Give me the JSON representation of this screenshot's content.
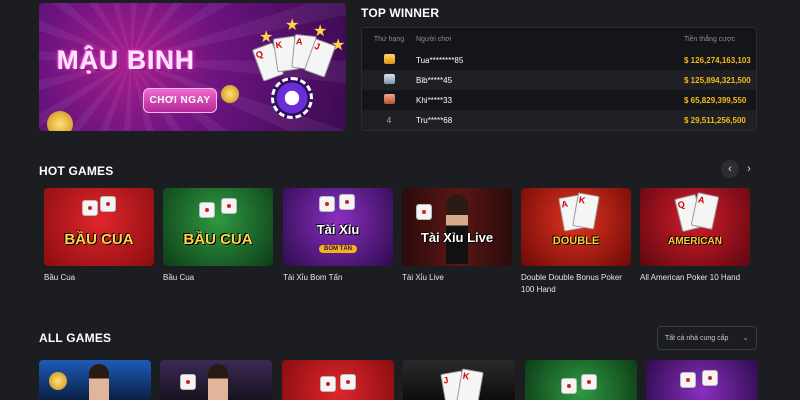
{
  "banner": {
    "title": "MẬU BINH",
    "button_label": "CHƠI NGAY"
  },
  "top_winner": {
    "title": "TOP WINNER",
    "headers": [
      "Thứ hạng",
      "Người chơi",
      "Tiền thắng cược"
    ],
    "rows": [
      {
        "rank": "",
        "medal": "gold-medal-icon",
        "player": "Tua********85",
        "amount": "$  126,274,163,103"
      },
      {
        "rank": "",
        "medal": "silver-medal-icon",
        "player": "Bib*****45",
        "amount": "$  125,894,321,500"
      },
      {
        "rank": "",
        "medal": "bronze-medal-icon",
        "player": "Khi*****33",
        "amount": "$  65,829,399,550"
      },
      {
        "rank": "4",
        "medal": "",
        "player": "Tru*****68",
        "amount": "$  29,511,256,500"
      }
    ]
  },
  "hot_games": {
    "title": "HOT GAMES",
    "prev_icon": "‹",
    "next_icon": "›",
    "items": [
      {
        "name": "Bầu Cua",
        "thumb_text": "BẦU CUA",
        "bg": "#b8141a"
      },
      {
        "name": "Bầu Cua",
        "thumb_text": "BẦU CUA",
        "bg": "#1b6b2a"
      },
      {
        "name": "Tài Xỉu Bom Tấn",
        "thumb_text": "Tài Xỉu",
        "thumb_sub": "BOM TẤN",
        "bg": "#5b1a8a"
      },
      {
        "name": "Tài Xỉu Live",
        "thumb_text": "Tài Xỉu Live",
        "bg": "#3a0f0f"
      },
      {
        "name": "Double Double Bonus Poker 100 Hand",
        "thumb_text": "DOUBLE",
        "bg": "#b0160f"
      },
      {
        "name": "All American Poker 10 Hand",
        "thumb_text": "AMERICAN",
        "bg": "#9c0e18"
      }
    ]
  },
  "all_games": {
    "title": "ALL GAMES",
    "provider_select": "Tất cả nhà cung cấp",
    "thumbs": [
      "#123a7a",
      "#2a1f3c",
      "#b3141a",
      "#1a1a1a",
      "#1d5e2c",
      "#5b1a8a"
    ]
  }
}
